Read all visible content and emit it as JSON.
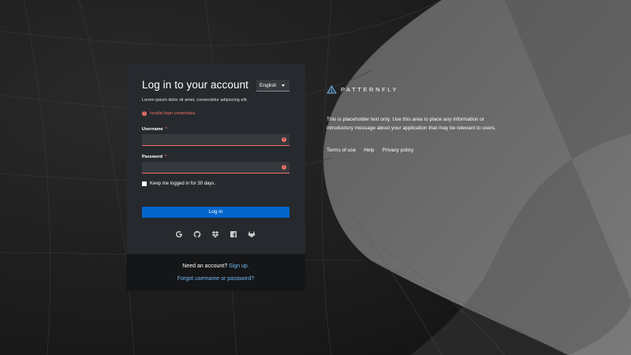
{
  "login": {
    "title": "Log in to your account",
    "language": "English",
    "subtitle": "Lorem ipsum dolor sit amet, consectetur adipiscing elit.",
    "error": "Invalid login credentials.",
    "username_label": "Username",
    "password_label": "Password",
    "required_mark": "*",
    "username_value": "",
    "password_value": "",
    "remember_label": "Keep me logged in for 30 days.",
    "remember_checked": false,
    "submit_label": "Log in",
    "social_icons": [
      "google-icon",
      "github-icon",
      "dropbox-icon",
      "facebook-icon",
      "gitlab-icon"
    ],
    "need_account": "Need an account?",
    "signup_link": "Sign up.",
    "forgot_link": "Forgot username or password?"
  },
  "brand": {
    "name": "PATTERNFLY",
    "info": "This is placeholder text only. Use this area to place any information or introductory message about your application that may be relevant to users.",
    "footer_links": [
      "Terms of use",
      "Help",
      "Privacy policy"
    ]
  },
  "colors": {
    "accent": "#0066cc",
    "error": "#f0706a",
    "link": "#73bcf7",
    "card": "#26292d"
  }
}
